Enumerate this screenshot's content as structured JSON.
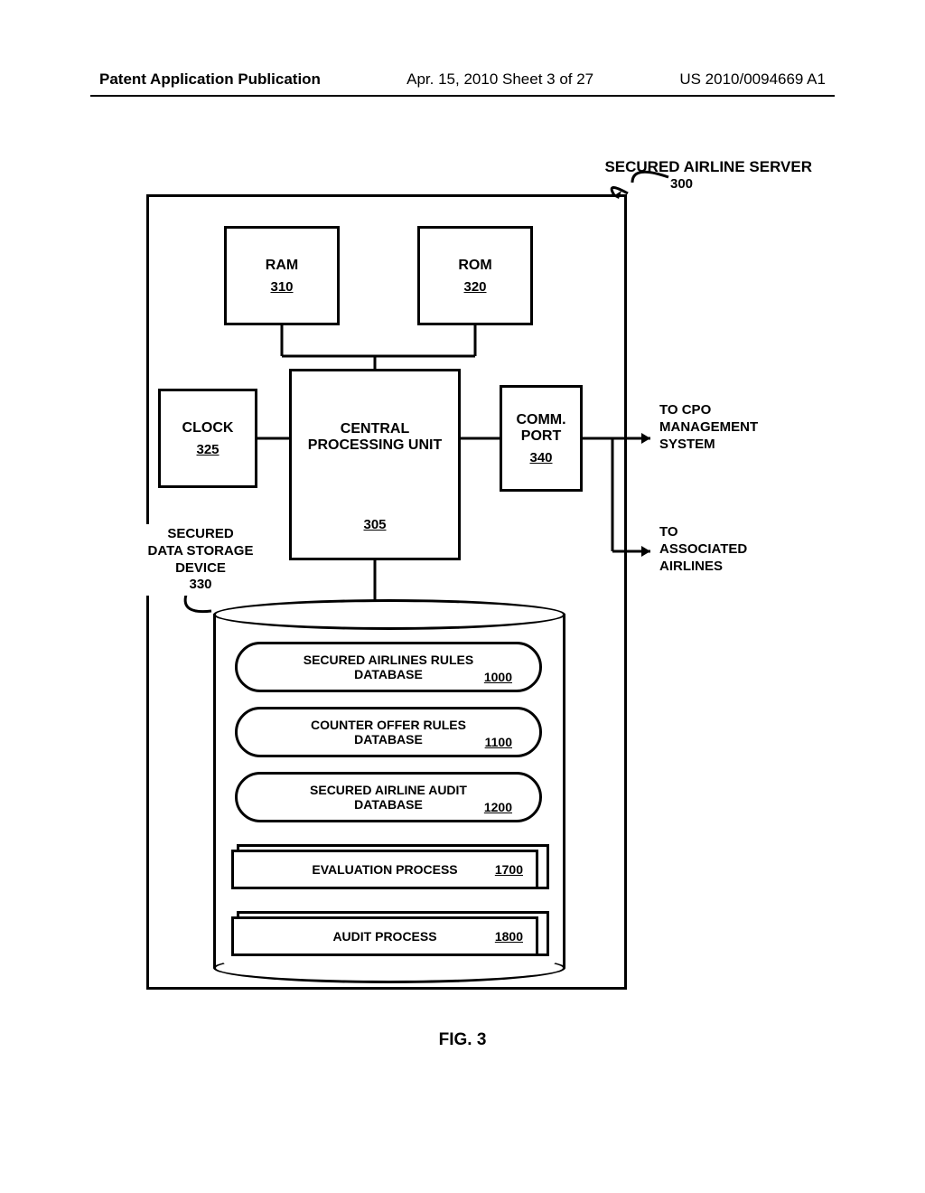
{
  "header": {
    "left": "Patent Application Publication",
    "center": "Apr. 15, 2010  Sheet 3 of 27",
    "right": "US 2010/0094669 A1"
  },
  "title": "SECURED AIRLINE SERVER",
  "title_ref": "300",
  "blocks": {
    "ram": {
      "label": "RAM",
      "ref": "310"
    },
    "rom": {
      "label": "ROM",
      "ref": "320"
    },
    "clock": {
      "label": "CLOCK",
      "ref": "325"
    },
    "cpu": {
      "label1": "CENTRAL",
      "label2": "PROCESSING UNIT",
      "ref": "305"
    },
    "comm": {
      "label1": "COMM.",
      "label2": "PORT",
      "ref": "340"
    }
  },
  "storage": {
    "label1": "SECURED",
    "label2": "DATA STORAGE",
    "label3": "DEVICE",
    "ref": "330"
  },
  "disks": [
    {
      "line1": "SECURED AIRLINES RULES",
      "line2": "DATABASE",
      "ref": "1000"
    },
    {
      "line1": "COUNTER OFFER RULES",
      "line2": "DATABASE",
      "ref": "1100"
    },
    {
      "line1": "SECURED AIRLINE AUDIT",
      "line2": "DATABASE",
      "ref": "1200"
    }
  ],
  "processes": [
    {
      "label": "EVALUATION PROCESS",
      "ref": "1700"
    },
    {
      "label": "AUDIT PROCESS",
      "ref": "1800"
    }
  ],
  "external": {
    "e1": {
      "l1": "TO CPO",
      "l2": "MANAGEMENT",
      "l3": "SYSTEM"
    },
    "e2": {
      "l1": "TO",
      "l2": "ASSOCIATED",
      "l3": "AIRLINES"
    }
  },
  "figure": "FIG. 3"
}
